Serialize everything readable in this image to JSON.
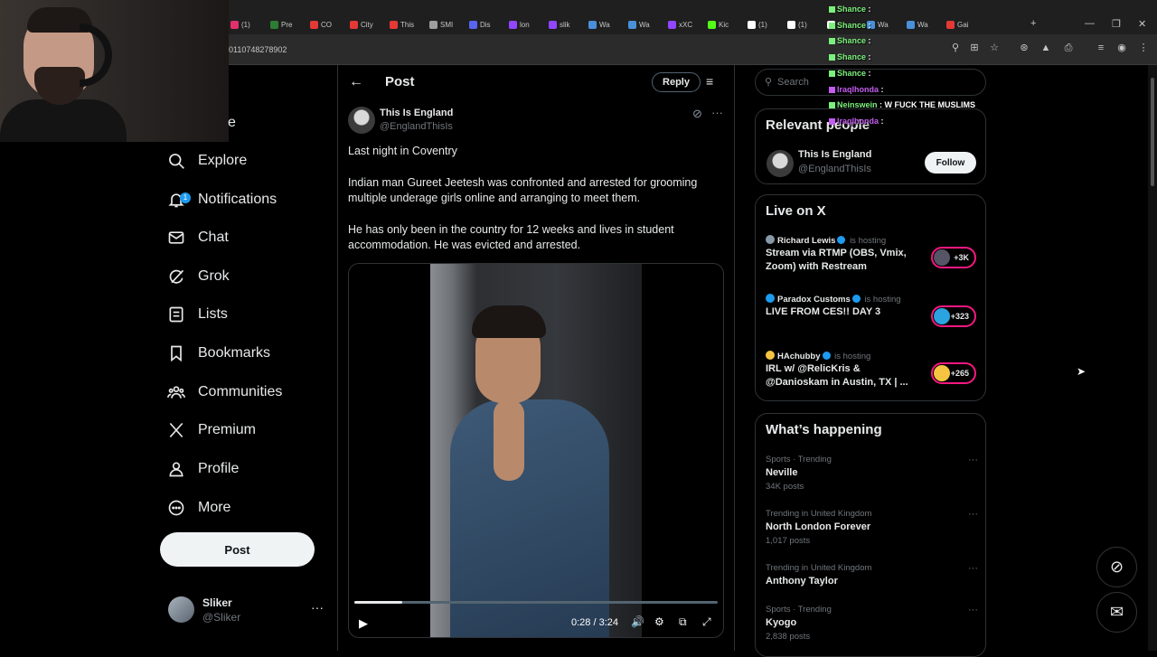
{
  "browser": {
    "tabs": [
      {
        "label": "(1)",
        "color": "#e1306c"
      },
      {
        "label": "Pre",
        "color": "#2e7d32"
      },
      {
        "label": "CO",
        "color": "#e53935"
      },
      {
        "label": "City",
        "color": "#e53935"
      },
      {
        "label": "This",
        "color": "#e53935"
      },
      {
        "label": "SMI",
        "color": "#9e9e9e"
      },
      {
        "label": "Dis",
        "color": "#5865f2"
      },
      {
        "label": "lon",
        "color": "#9146ff"
      },
      {
        "label": "slik",
        "color": "#9146ff"
      },
      {
        "label": "Wa",
        "color": "#4a90d9"
      },
      {
        "label": "Wa",
        "color": "#4a90d9"
      },
      {
        "label": "xXC",
        "color": "#9146ff"
      },
      {
        "label": "Kic",
        "color": "#53fc18"
      },
      {
        "label": "(1)",
        "color": "#ffffff"
      },
      {
        "label": "(1)",
        "color": "#ffffff"
      },
      {
        "label": "",
        "color": "#ffffff"
      },
      {
        "label": "Wa",
        "color": "#4a90d9"
      },
      {
        "label": "Wa",
        "color": "#4a90d9"
      },
      {
        "label": "Gai",
        "color": "#e53935"
      }
    ],
    "url": "0110748278902"
  },
  "nav": {
    "home_partial": "e",
    "explore": "Explore",
    "notifications": "Notifications",
    "notifications_badge": "1",
    "chat": "Chat",
    "grok": "Grok",
    "lists": "Lists",
    "bookmarks": "Bookmarks",
    "communities": "Communities",
    "premium": "Premium",
    "profile": "Profile",
    "more": "More",
    "post_button": "Post",
    "account": {
      "name": "Sliker",
      "handle": "@Sliker",
      "more": "···"
    }
  },
  "main": {
    "header_title": "Post",
    "reply_label": "Reply",
    "author": {
      "name": "This Is England",
      "handle": "@EnglandThisIs"
    },
    "paragraphs": [
      "Last night in Coventry",
      "Indian man Gureet Jeetesh was confronted and arrested for grooming multiple underage girls online and arranging to meet them.",
      "He has only been in the country for 12 weeks and lives in student accommodation. He was evicted and arrested."
    ],
    "video": {
      "time": "0:28 / 3:24",
      "progress": 0.133
    }
  },
  "right": {
    "search_placeholder": "Search",
    "relevant_title": "Relevant people",
    "relevant": {
      "name": "This Is England",
      "handle": "@EnglandThisIs",
      "follow_label": "Follow"
    },
    "live_title": "Live on X",
    "live": [
      {
        "host": "Richard Lewis",
        "hosting": "is hosting",
        "title": "Stream via RTMP (OBS, Vmix, Zoom) with Restream",
        "count": "+3K"
      },
      {
        "host": "Paradox Customs",
        "hosting": "is hosting",
        "title": "LIVE FROM CES!! DAY 3",
        "count": "+323"
      },
      {
        "host": "HAchubby",
        "hosting": "is hosting",
        "title": "IRL w/ @RelicKris & @Danioskam in Austin, TX | ...",
        "count": "+265"
      }
    ],
    "happening_title": "What’s happening",
    "trends": [
      {
        "category": "Sports · Trending",
        "name": "Neville",
        "count": "34K posts"
      },
      {
        "category": "Trending in United Kingdom",
        "name": "North London Forever",
        "count": "1,017 posts"
      },
      {
        "category": "Trending in United Kingdom",
        "name": "Anthony Taylor",
        "count": ""
      },
      {
        "category": "Sports · Trending",
        "name": "Kyogo",
        "count": "2,838 posts"
      }
    ],
    "trend_more": "···"
  },
  "chat_overlay": [
    {
      "user": "Shance",
      "msg": "",
      "color": "#7cf07c"
    },
    {
      "user": "Shance",
      "msg": "",
      "color": "#7cf07c"
    },
    {
      "user": "Shance",
      "msg": "",
      "color": "#7cf07c"
    },
    {
      "user": "Shance",
      "msg": "",
      "color": "#7cf07c"
    },
    {
      "user": "Shance",
      "msg": "",
      "color": "#7cf07c"
    },
    {
      "user": "Iraqlhonda",
      "msg": "",
      "color": "#c45cf0"
    },
    {
      "user": "Neinswein",
      "msg": "W FUCK THE MUSLIMS",
      "color": "#7cf07c"
    },
    {
      "user": "Iraqlhonda",
      "msg": "",
      "color": "#c45cf0"
    }
  ]
}
